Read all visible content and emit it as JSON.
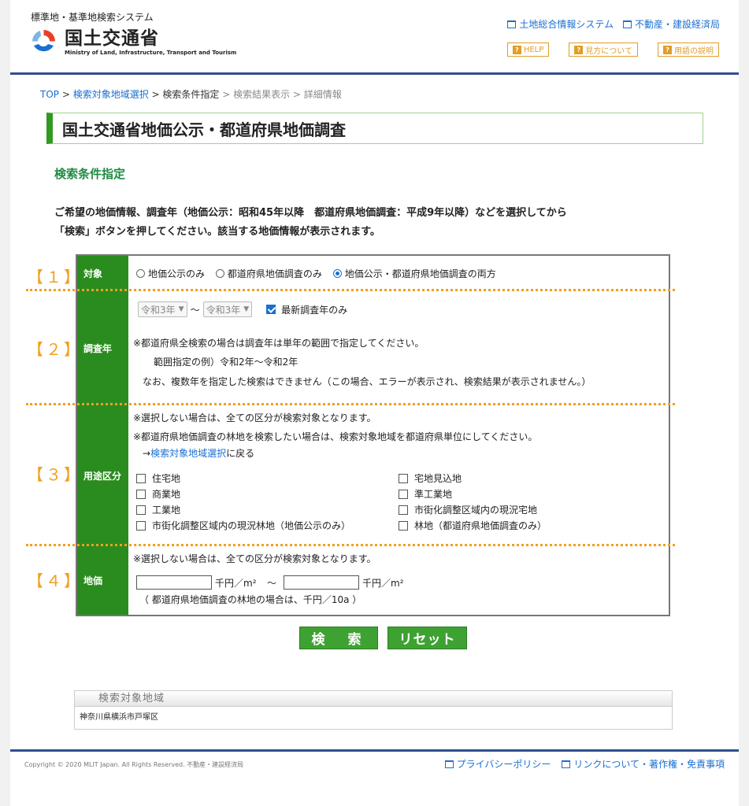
{
  "header": {
    "system_name": "標準地・基準地検索システム",
    "logo_jp": "国土交通省",
    "logo_en": "Ministry of Land, Infrastructure, Transport and Tourism",
    "links": [
      "土地総合情報システム",
      "不動産・建設経済局"
    ],
    "buttons": [
      "HELP",
      "見方について",
      "用語の説明"
    ]
  },
  "breadcrumb": {
    "top": "TOP",
    "sep1": " > ",
    "step1": "検索対象地域選択",
    "sep2": " > ",
    "step2": "検索条件指定",
    "rest": " > 検索結果表示 > 詳細情報"
  },
  "page_title": "国土交通省地価公示・都道府県地価調査",
  "section_title": "検索条件指定",
  "intro_lines": [
    "ご希望の地価情報、調査年（地価公示：昭和45年以降　都道府県地価調査：平成9年以降）などを選択してから",
    "「検索」ボタンを押してください。該当する地価情報が表示されます。"
  ],
  "form": {
    "s1": {
      "num": "【１】",
      "label": "対象",
      "options": [
        "地価公示のみ",
        "都道府県地価調査のみ",
        "地価公示・都道府県地価調査の両方"
      ],
      "selected_index": 2
    },
    "s2": {
      "num": "【２】",
      "label": "調査年",
      "year_from": "令和3年",
      "year_sep": "～",
      "year_to": "令和3年",
      "latest_only_label": "最新調査年のみ",
      "latest_only_checked": true,
      "note1": "※都道府県全検索の場合は調査年は単年の範囲で指定してください。",
      "note2": "範囲指定の例）令和2年～令和2年",
      "note3": "なお、複数年を指定した検索はできません（この場合、エラーが表示され、検索結果が表示されません。）"
    },
    "s3": {
      "num": "【３】",
      "label": "用途区分",
      "note1": "※選択しない場合は、全ての区分が検索対象となります。",
      "note2": "※都道府県地価調査の林地を検索したい場合は、検索対象地域を都道府県単位にしてください。",
      "back_arrow": "→",
      "back_link": "検索対象地域選択",
      "back_suffix": "に戻る",
      "left": [
        "住宅地",
        "商業地",
        "工業地",
        "市街化調整区域内の現況林地（地価公示のみ）"
      ],
      "right": [
        "宅地見込地",
        "準工業地",
        "市街化調整区域内の現況宅地",
        "林地（都道府県地価調査のみ）"
      ]
    },
    "s4": {
      "num": "【４】",
      "label": "地価",
      "note1": "※選択しない場合は、全ての区分が検索対象となります。",
      "from_value": "",
      "unit": "千円／m²",
      "tilde": "～",
      "to_value": "",
      "note2": "（ 都道府県地価調査の林地の場合は、千円／10a ）"
    }
  },
  "buttons": {
    "search": "検　索",
    "reset": "リセット"
  },
  "area": {
    "header": "検索対象地域",
    "value": "神奈川県横浜市戸塚区"
  },
  "footer": {
    "copyright": "Copyright © 2020  MLIT Japan. All Rights Reserved. 不動産・建設経済局",
    "links": [
      "プライバシーポリシー",
      "リンクについて・著作権・免責事項"
    ]
  },
  "colors": {
    "accent_green": "#2a8c1e",
    "link_blue": "#1a6fd1",
    "orange": "#f0a020",
    "navy": "#2f4f8f"
  }
}
